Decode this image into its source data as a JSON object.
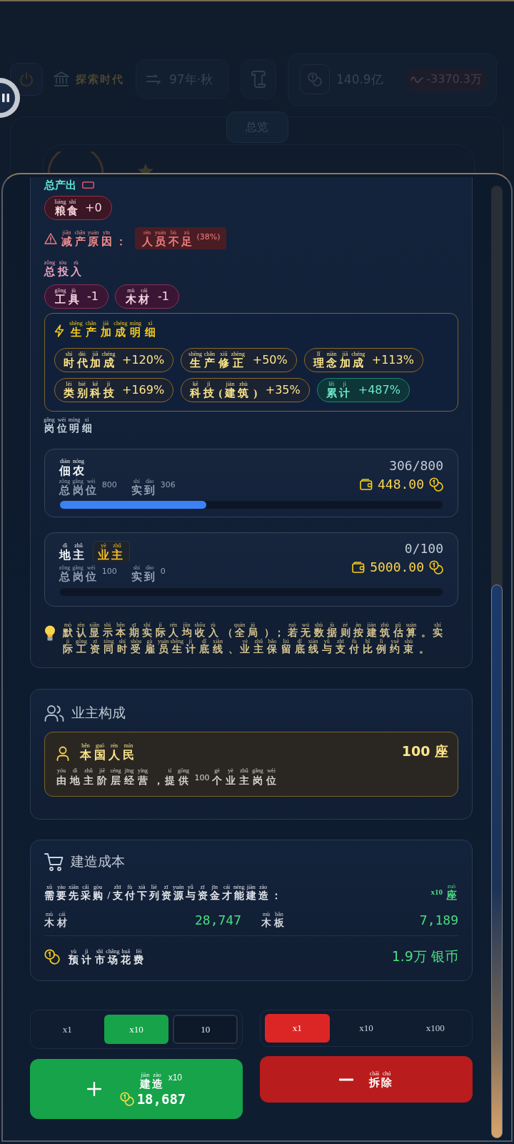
{
  "backdrop": {
    "era": "探索时代",
    "date": "97年·秋",
    "treasury": "140.9亿",
    "income": "-3370.3万",
    "tab": "总览"
  },
  "output": {
    "label": "总产出",
    "items": [
      {
        "name": "粮食",
        "pinyin": "liáng shí",
        "amount": "+0"
      }
    ],
    "reduction": {
      "label": "减产原因：",
      "pinyin": "jiǎn chǎn yuán yīn",
      "reason": "人员不足",
      "reason_pinyin": "rén yuán bù zú",
      "share": "(38%)"
    }
  },
  "input": {
    "label": "总投入",
    "pinyin": "zǒng tóu rù",
    "items": [
      {
        "name": "工具",
        "pinyin": "gōng jù",
        "amount": "-1"
      },
      {
        "name": "木材",
        "pinyin": "mù cái",
        "amount": "-1"
      }
    ]
  },
  "bonus": {
    "title": "生产加成明细",
    "pinyin": "shēng chǎn jiā chéng míng xì",
    "chips": [
      {
        "kind": "part",
        "name": "时代加成",
        "pinyin": "shí dài jiā chéng",
        "value": "+120%"
      },
      {
        "kind": "part",
        "name": "生产修正",
        "pinyin": "shēng chǎn xiū zhèng",
        "value": "+50%"
      },
      {
        "kind": "part",
        "name": "理念加成",
        "pinyin": "lǐ niàn jiā chéng",
        "value": "+113%"
      },
      {
        "kind": "part",
        "name": "类别科技",
        "pinyin": "lèi bié kē jì",
        "value": "+169%"
      },
      {
        "kind": "part",
        "name": "科技(建筑)",
        "pinyin": "kē jì jiàn zhù",
        "value": "+35%"
      },
      {
        "kind": "total",
        "name": "累计",
        "pinyin": "lěi jì",
        "value": "+487%"
      }
    ]
  },
  "jobs": {
    "title": "岗位明细",
    "pinyin": "gǎng wèi míng xì",
    "cards": [
      {
        "name": "佃农",
        "pinyin": "diàn nóng",
        "stats": [
          {
            "label": "总岗位",
            "pinyin": "zǒng gǎng wèi",
            "value": "800"
          },
          {
            "label": "实到",
            "pinyin": "shí dào",
            "value": "306"
          }
        ],
        "count": "306/800",
        "wage": "448.00",
        "level": 0.3825
      },
      {
        "name": "地主",
        "pinyin": "dì zhǔ",
        "tag": {
          "text": "业主",
          "pinyin": "yè zhǔ"
        },
        "stats": [
          {
            "label": "总岗位",
            "pinyin": "zǒng gǎng wèi",
            "value": "100"
          },
          {
            "label": "实到",
            "pinyin": "shí dào",
            "value": "0"
          }
        ],
        "count": "0/100",
        "wage": "5000.00"
      }
    ]
  },
  "hint": {
    "lines": [
      {
        "text": "默认显示本期实际人均收入（全局）；若无数据则按建筑估算。实",
        "pinyin": "mò rèn xiǎn shì běn qī shí jì rén jūn shōu rù quán jú ruò wú shù jù zé àn jiàn zhù gū suàn shí"
      },
      {
        "text": "际工资同时受雇员生计底线、业主保留底线与支付比例约束。",
        "pinyin": "jì gōng zī tóng shí shòu gù yuán shēng jì dǐ xiàn yè zhǔ bǎo liú dǐ xiàn yǔ zhī fù bǐ lì yuē shù"
      }
    ]
  },
  "owners": {
    "title": "业主构成",
    "items": [
      {
        "name": "本国人民",
        "pinyin": "běn guó rén mín",
        "count": "100 座",
        "desc": "由地主阶层经营，提供100个业主岗位",
        "desc_pinyin": "yóu dì zhǔ jiē céng jīng yíng tí gōng gè yè zhǔ gǎng wèi"
      }
    ]
  },
  "cost": {
    "title": "建造成本",
    "note": "需要先采购/支付下列资源与资金才能建造：",
    "note_pinyin": "xū yào xiān cǎi gòu zhī fù xià liè zī yuán yǔ zī jīn cái néng jiàn zào",
    "batch": "x10",
    "unit": "座",
    "unit_pinyin": "zuò",
    "resources": [
      {
        "name": "木材",
        "pinyin": "mù cái",
        "amount": "28,747"
      },
      {
        "name": "木板",
        "pinyin": "mù bǎn",
        "amount": "7,189"
      }
    ],
    "market": {
      "label": "预计市场花费",
      "pinyin": "yù jì shì chǎng huā fèi",
      "amount": "1.9万 银币"
    }
  },
  "build_amounts": {
    "options": [
      {
        "label": "x1",
        "selected": false
      },
      {
        "label": "x10",
        "selected": true
      }
    ],
    "custom_value": "10"
  },
  "demolish_amounts": {
    "options": [
      {
        "label": "x1",
        "selected": true
      },
      {
        "label": "x10",
        "selected": false
      },
      {
        "label": "x100",
        "selected": false
      }
    ]
  },
  "build_button": {
    "label": "建造",
    "pinyin": "jiàn zào",
    "batch": "x10",
    "cost": "18,687"
  },
  "demolish_button": {
    "label": "拆除",
    "pinyin": "chāi chú"
  }
}
